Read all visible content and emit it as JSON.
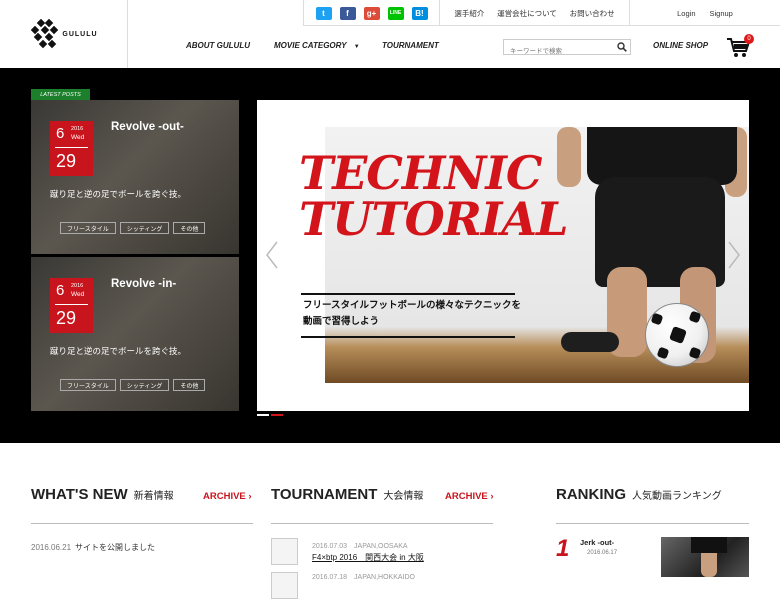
{
  "brand": {
    "name": "GULULU"
  },
  "social": [
    {
      "label": "t",
      "icon": "twitter-icon",
      "color": "#1da1f2"
    },
    {
      "label": "f",
      "icon": "facebook-icon",
      "color": "#3b5998"
    },
    {
      "label": "g+",
      "icon": "google-plus-icon",
      "color": "#dd4b39"
    },
    {
      "label": "LINE",
      "icon": "line-icon",
      "color": "#00c300"
    },
    {
      "label": "B!",
      "icon": "hatena-bookmark-icon",
      "color": "#008fde"
    }
  ],
  "toplinks": [
    "選手紹介",
    "運営会社について",
    "お問い合わせ"
  ],
  "auth": {
    "login": "Login",
    "signup": "Signup"
  },
  "nav": {
    "about": "ABOUT GULULU",
    "movie": "MOVIE CATEGORY",
    "tournament": "TOURNAMENT",
    "shop": "ONLINE SHOP"
  },
  "search": {
    "placeholder": "キーワードで検索"
  },
  "cart": {
    "count": "0"
  },
  "latest": {
    "tag": "LATEST POSTS",
    "posts": [
      {
        "month": "6",
        "year": "2016",
        "weekday": "Wed",
        "day": "29",
        "title": "Revolve -out-",
        "desc": "蹴り足と逆の足でボールを跨ぐ技。",
        "tags": [
          "フリースタイル",
          "シッティング",
          "その他"
        ]
      },
      {
        "month": "6",
        "year": "2016",
        "weekday": "Wed",
        "day": "29",
        "title": "Revolve -in-",
        "desc": "蹴り足と逆の足でボールを跨ぐ技。",
        "tags": [
          "フリースタイル",
          "シッティング",
          "その他"
        ]
      }
    ]
  },
  "slide": {
    "title_line1": "TECHNIC",
    "title_line2": "TUTORIAL",
    "subtitle_line1": "フリースタイルフットボールの様々なテクニックを",
    "subtitle_line2": "動画で習得しよう",
    "dots_active": 1,
    "dots_total": 2
  },
  "whatsnew": {
    "title": "WHAT'S NEW",
    "jp": "新着情報",
    "archive": "ARCHIVE ›",
    "items": [
      {
        "date": "2016.06.21",
        "text": "サイトを公開しました"
      }
    ]
  },
  "tournament": {
    "title": "TOURNAMENT",
    "jp": "大会情報",
    "archive": "ARCHIVE ›",
    "items": [
      {
        "meta": "2016.07.03　JAPAN,OOSAKA",
        "name": "F4×btp 2016　関西大会 in 大阪"
      },
      {
        "meta": "2016.07.18　JAPAN,HOKKAIDO",
        "name": ""
      }
    ]
  },
  "ranking": {
    "title": "RANKING",
    "jp": "人気動画ランキング",
    "items": [
      {
        "rank": "1",
        "title": "Jerk -out-",
        "date": "2016.06.17"
      }
    ]
  },
  "colors": {
    "accent": "#c8141c",
    "latest_tag": "#1b7f2b",
    "hero_bg": "#000000"
  }
}
